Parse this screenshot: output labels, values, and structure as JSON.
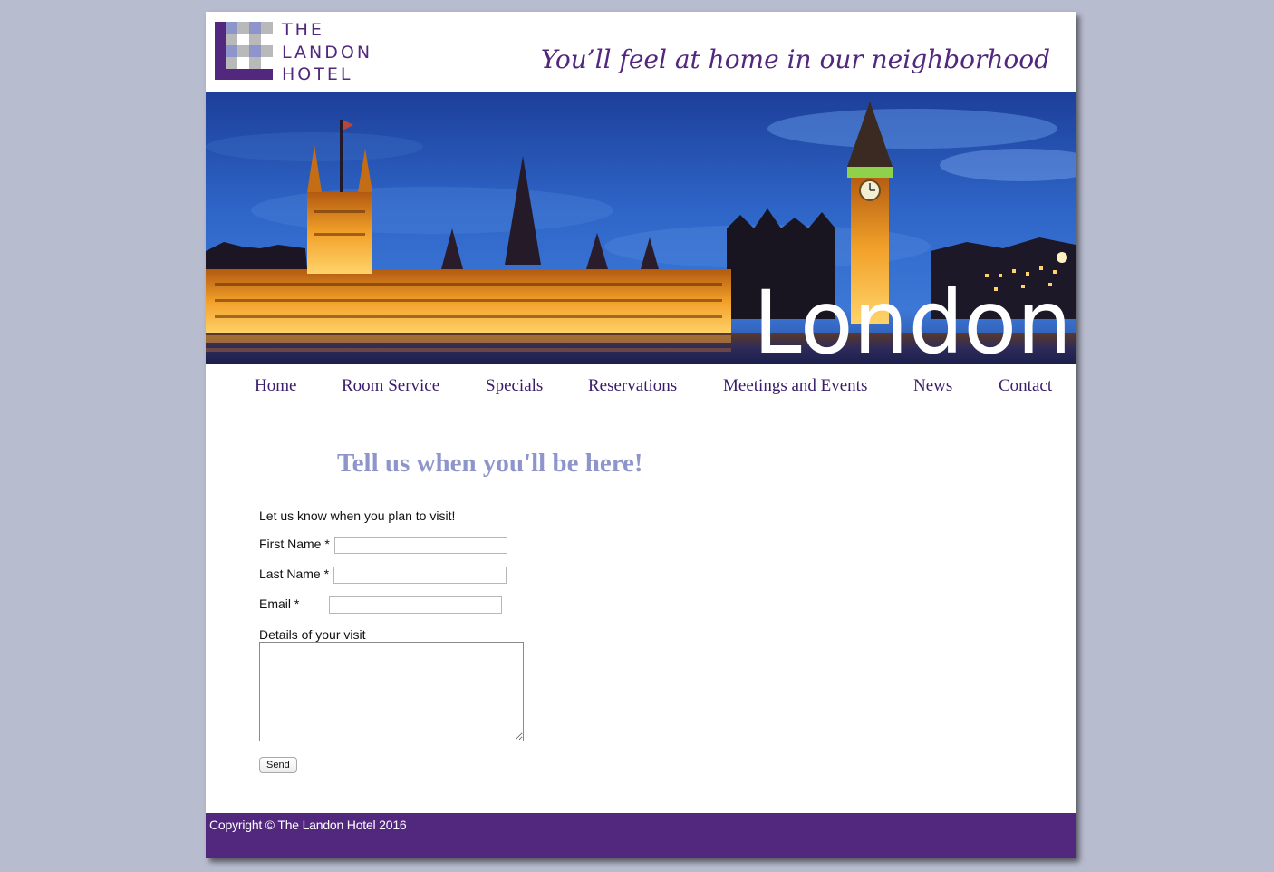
{
  "header": {
    "logo_lines": [
      "THE",
      "LANDON",
      "HOTEL"
    ],
    "tagline": "You’ll feel at home in our neighborhood"
  },
  "hero": {
    "word": "London"
  },
  "nav": {
    "items": [
      "Home",
      "Room Service",
      "Specials",
      "Reservations",
      "Meetings and Events",
      "News",
      "Contact"
    ]
  },
  "main": {
    "heading": "Tell us when you'll be here!",
    "intro": "Let us know when you plan to visit!",
    "first_name_label": "First Name *",
    "last_name_label": "Last Name *",
    "email_label": "Email *",
    "details_label": "Details of your visit",
    "send_label": "Send",
    "first_name_value": "",
    "last_name_value": "",
    "email_value": "",
    "details_value": ""
  },
  "footer": {
    "copyright": "Copyright © The Landon Hotel 2016"
  },
  "colors": {
    "brand_purple": "#52287e",
    "heading_lavender": "#8e95cb",
    "page_background": "#b8bccf"
  }
}
